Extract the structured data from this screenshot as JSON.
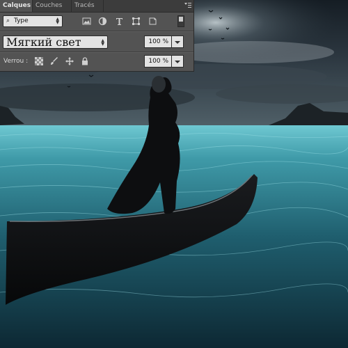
{
  "layers_panel": {
    "tabs": [
      {
        "label": "Calques",
        "active": true
      },
      {
        "label": "Couches",
        "active": false
      },
      {
        "label": "Tracés",
        "active": false
      }
    ],
    "filter": {
      "icon": "search-icon",
      "value": "Type"
    },
    "filter_icons": [
      "image-filter-icon",
      "adjustment-filter-icon",
      "type-filter-icon",
      "shape-filter-icon",
      "smart-object-filter-icon"
    ],
    "blend_mode": "Мягкий свет",
    "opacity_value": "100 %",
    "lock_label": "Verrou :",
    "lock_icons": [
      "lock-transparent-pixels-icon",
      "lock-image-pixels-icon",
      "lock-position-icon",
      "lock-all-icon"
    ],
    "fill_value": "100 %"
  },
  "canvas": {
    "description_colors": {
      "sky": "#1f2a33",
      "sea": "#2f7f8f",
      "boat": "#0c0d0f"
    }
  }
}
